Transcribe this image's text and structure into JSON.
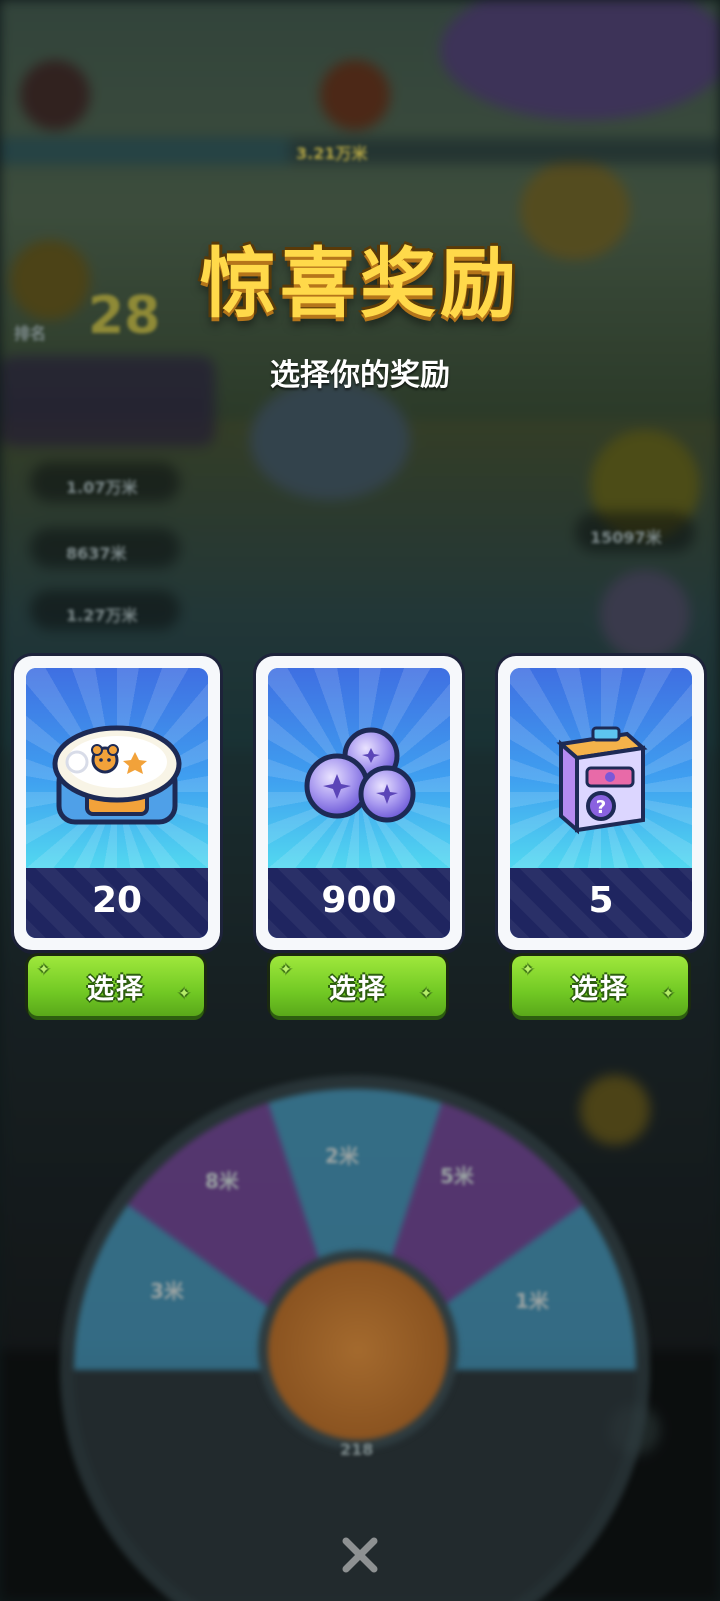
{
  "modal": {
    "title": "惊喜奖励",
    "subtitle": "选择你的奖励",
    "close_icon": "close-icon"
  },
  "rewards": [
    {
      "icon": "lunchbox-icon",
      "value": "20",
      "button_label": "选择"
    },
    {
      "icon": "purple-orbs-icon",
      "value": "900",
      "button_label": "选择"
    },
    {
      "icon": "mystery-box-icon",
      "value": "5",
      "button_label": "选择"
    }
  ],
  "background": {
    "rank_number": "28",
    "rank_label": "排名",
    "score_rows": [
      "1.07万米",
      "8637米",
      "1.27万米"
    ],
    "progress_label": "3.21万米",
    "right_score": "15097米",
    "wheel_labels": [
      "2米",
      "5米",
      "8米",
      "1米",
      "3米"
    ],
    "bottom_count": "218"
  },
  "colors": {
    "title": "#ffd94a",
    "card_band": "#1f2560",
    "button": "#72c924"
  }
}
